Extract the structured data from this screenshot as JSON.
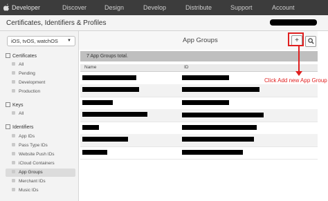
{
  "topnav": {
    "brand": "Developer",
    "items": [
      "Discover",
      "Design",
      "Develop",
      "Distribute",
      "Support",
      "Account"
    ]
  },
  "header": {
    "title": "Certificates, Identifiers & Profiles"
  },
  "sidebar": {
    "platform": "iOS, tvOS, watchOS",
    "sections": [
      {
        "title": "Certificates",
        "items": [
          "All",
          "Pending",
          "Development",
          "Production"
        ]
      },
      {
        "title": "Keys",
        "items": [
          "All"
        ]
      },
      {
        "title": "Identifiers",
        "items": [
          "App IDs",
          "Pass Type IDs",
          "Website Push IDs",
          "iCloud Containers",
          "App Groups",
          "Merchant IDs",
          "Music IDs"
        ]
      }
    ],
    "selected": "App Groups"
  },
  "main": {
    "title": "App Groups",
    "add_button": "+",
    "count_text": "7  App Groups total.",
    "columns": [
      "Name",
      "ID"
    ]
  },
  "annotation": {
    "callout": "Click Add new App Group",
    "color": "#e02020"
  },
  "icons": {
    "apple": "apple-logo-icon",
    "add": "plus-icon",
    "search": "search-icon",
    "chevron": "chevron-down-icon"
  }
}
